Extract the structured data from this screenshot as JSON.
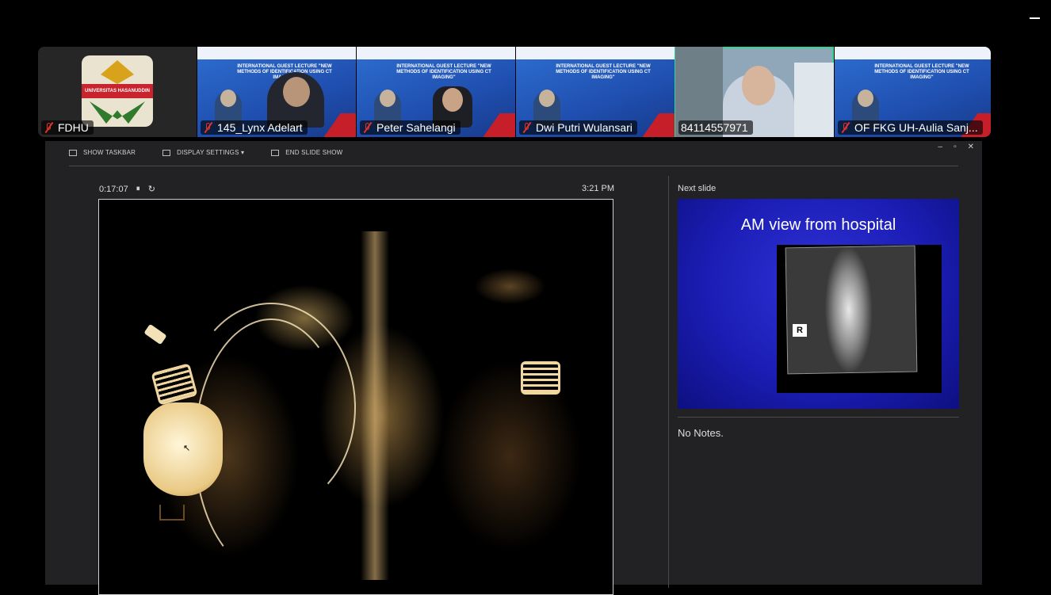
{
  "participants": [
    {
      "name": "FDHU"
    },
    {
      "name": "145_Lynx Adelart"
    },
    {
      "name": "Peter Sahelangi"
    },
    {
      "name": "Dwi Putri Wulansari"
    },
    {
      "name": "84114557971"
    },
    {
      "name": "OF FKG UH-Aulia Sanj..."
    }
  ],
  "fdhu_logo_text": "UNIVERSITAS HASANUDDIN",
  "slide_thumb_title": "INTERNATIONAL GUEST LECTURE \"NEW METHODS OF IDENTIFICATION USING CT IMAGING\"",
  "toolbar": {
    "show_taskbar": "SHOW TASKBAR",
    "display_settings": "DISPLAY SETTINGS ▾",
    "end_slide_show": "END SLIDE SHOW"
  },
  "window_controls": {
    "minimize": "–",
    "restore": "▫",
    "close": "✕"
  },
  "timer": {
    "elapsed": "0:17:07",
    "pause": "⏸",
    "restart": "↻",
    "clock": "3:21 PM"
  },
  "next_slide": {
    "label": "Next slide",
    "title": "AM view from hospital",
    "marker": "R"
  },
  "notes": "No Notes.",
  "colors": {
    "speaker_highlight": "#33d49a",
    "muted_mic": "#e0332b",
    "slide_blue": "#1b1db5"
  }
}
